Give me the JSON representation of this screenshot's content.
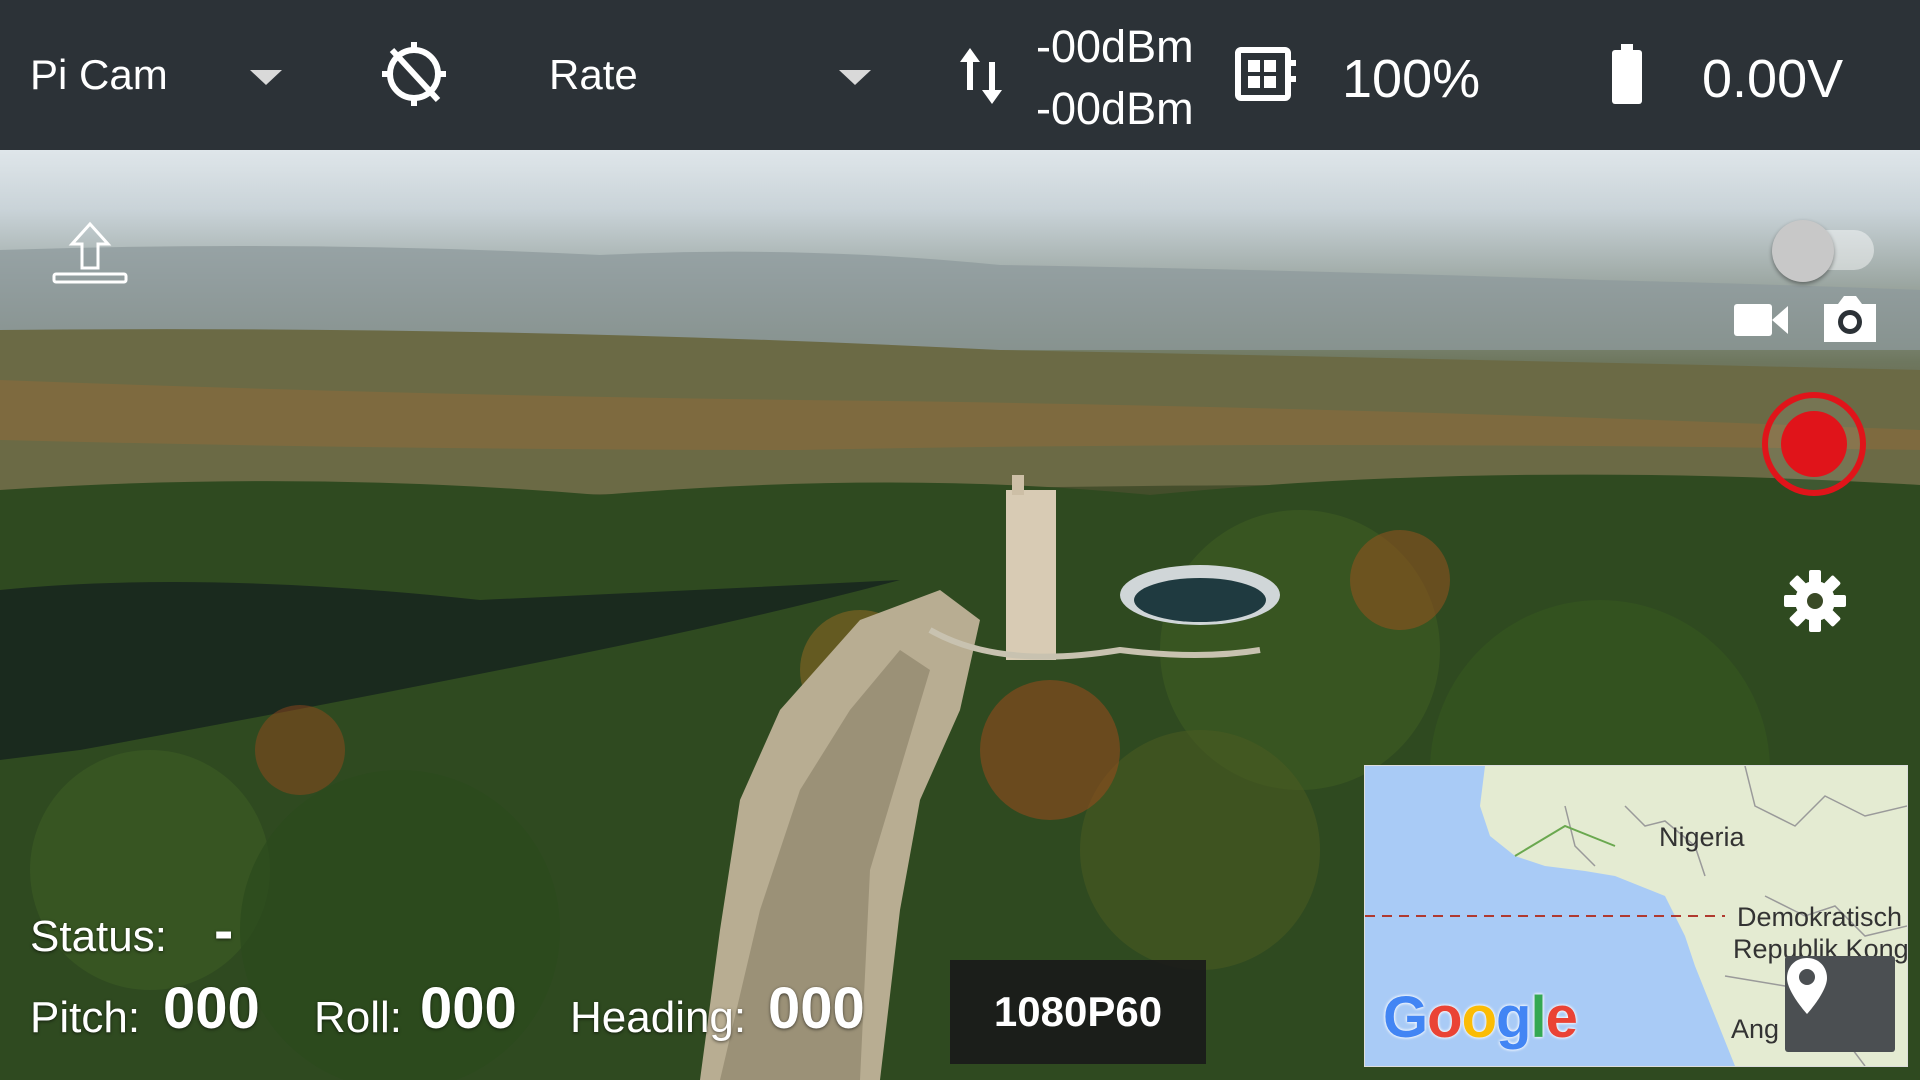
{
  "topbar": {
    "camera_select": {
      "value": "Pi Cam"
    },
    "gps_status_icon": "gps-off-icon",
    "mode_select": {
      "value": "Rate"
    },
    "signal": {
      "icon": "signal-up-down-icon",
      "uplink": "-00dBm",
      "downlink": "-00dBm"
    },
    "cpu": {
      "icon": "cpu-icon",
      "value": "100%"
    },
    "battery": {
      "icon": "battery-icon",
      "value": "0.00V"
    }
  },
  "controls": {
    "upload_icon": "upload-icon",
    "toggle": {
      "state": "off"
    },
    "video_icon": "video-camera-icon",
    "photo_icon": "camera-icon",
    "record_icon": "record-icon",
    "settings_icon": "gear-icon"
  },
  "telemetry": {
    "status_label": "Status:",
    "status_value": "-",
    "pitch_label": "Pitch:",
    "pitch_value": "000",
    "roll_label": "Roll:",
    "roll_value": "000",
    "heading_label": "Heading:",
    "heading_value": "000"
  },
  "resolution": "1080P60",
  "map": {
    "labels": [
      "Nigeria",
      "Demokratisch",
      "Republik Kong",
      "Ang"
    ],
    "logo": "Google",
    "location_icon": "map-pin-icon"
  },
  "colors": {
    "topbar_bg": "#2c3237",
    "record_red": "#e0141a",
    "map_water": "#a9cbf6",
    "map_land": "#e4ebd2"
  }
}
